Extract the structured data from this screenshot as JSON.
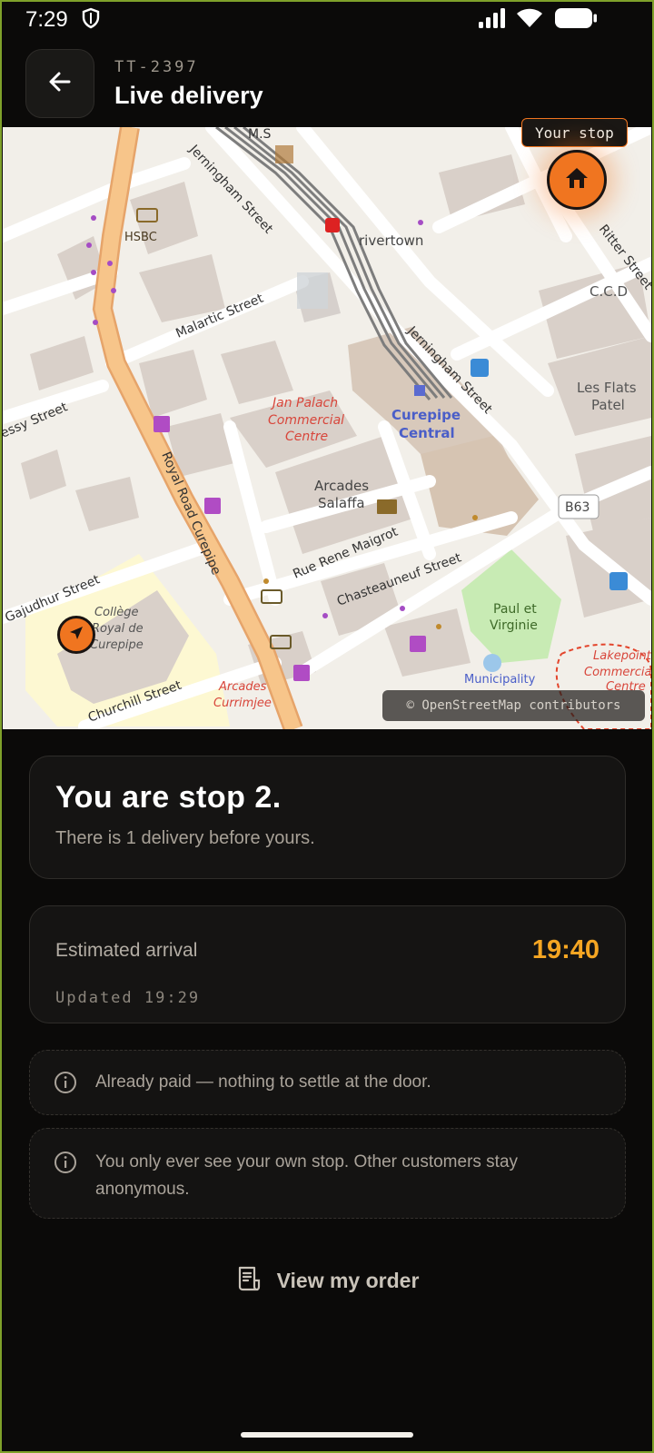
{
  "status_bar": {
    "time": "7:29"
  },
  "header": {
    "order_id": "TT-2397",
    "title": "Live delivery"
  },
  "map": {
    "your_stop_label": "Your stop",
    "attribution": "© OpenStreetMap contributors",
    "labels": {
      "jerningham_top": "Jerningham Street",
      "jerningham_mid": "Jerningham Street",
      "ms": "M.S",
      "hsbc": "HSBC",
      "rivertown": "rivertown",
      "ritter": "Ritter Street",
      "ccd": "C.C.D",
      "malartic": "Malartic Street",
      "les_flats_1": "Les Flats",
      "les_flats_2": "Patel",
      "essy": "essy Street",
      "jan_palach_1": "Jan Palach",
      "jan_palach_2": "Commercial",
      "jan_palach_3": "Centre",
      "curepipe_central_1": "Curepipe",
      "curepipe_central_2": "Central",
      "royal_road": "Royal Road Curepipe",
      "arcades_salaffa_1": "Arcades",
      "arcades_salaffa_2": "Salaffa",
      "b63": "B63",
      "rue_rene": "Rue Rene Maigrot",
      "chasteauneuf": "Chasteauneuf Street",
      "gajudhur": "Gajudhur Street",
      "college_1": "Collège",
      "college_2": "Royal de",
      "college_3": "Curepipe",
      "paul_1": "Paul et",
      "paul_2": "Virginie",
      "lakepoint_1": "Lakepoint",
      "lakepoint_2": "Commercial",
      "lakepoint_3": "Centre",
      "municipality": "Municipality",
      "churchill": "Churchill Street",
      "arcades_currimjee_1": "Arcades",
      "arcades_currimjee_2": "Currimjee"
    },
    "colors": {
      "accent": "#f07520",
      "road_main": "#f7c58a",
      "building": "#d9d0c9",
      "park": "#c8ebb4"
    }
  },
  "stop_card": {
    "title": "You are stop 2.",
    "subtitle": "There is 1 delivery before yours."
  },
  "eta_card": {
    "label": "Estimated arrival",
    "value": "19:40",
    "updated": "Updated 19:29"
  },
  "notes": [
    {
      "icon": "info-icon",
      "text": "Already paid — nothing to settle at the door."
    },
    {
      "icon": "info-icon",
      "text": "You only ever see your own stop. Other customers stay anonymous."
    }
  ],
  "actions": {
    "view_order_label": "View my order",
    "view_order_icon": "receipt-icon"
  },
  "colors": {
    "background": "#0b0a09",
    "card": "#151413",
    "eta": "#f5a623",
    "accent": "#f07520"
  }
}
